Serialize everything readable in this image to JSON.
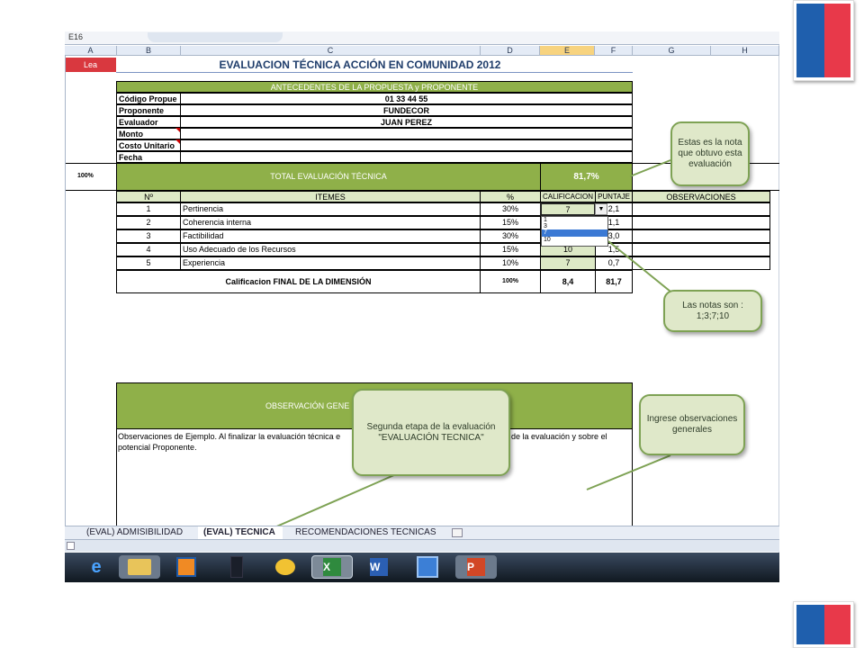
{
  "spreadsheet": {
    "cell_ref": "E16",
    "columns": [
      "A",
      "B",
      "C",
      "D",
      "E",
      "F",
      "G",
      "H"
    ],
    "lea_label": "Lea",
    "title": "EVALUACION TÉCNICA ACCIÓN EN COMUNIDAD 2012",
    "antecedentes_header": "ANTECEDENTES DE LA PROPUESTA y PROPONENTE",
    "info_rows": [
      {
        "label": "Código Propue",
        "value": "01 33 44 55"
      },
      {
        "label": "Proponente",
        "value": "FUNDECOR"
      },
      {
        "label": "Evaluador",
        "value": "JUAN PEREZ"
      },
      {
        "label": "Monto",
        "value": ""
      },
      {
        "label": "Costo Unitario",
        "value": ""
      },
      {
        "label": "Fecha",
        "value": ""
      }
    ],
    "total_pct_label": "100%",
    "total_label": "TOTAL EVALUACIÓN TÉCNICA",
    "total_value": "81,7%",
    "table_headers": {
      "n": "Nº",
      "items": "ITEMES",
      "pct": "%",
      "calif": "CALIFICACION",
      "puntaje": "PUNTAJE",
      "obs": "OBSERVACIONES"
    },
    "items": [
      {
        "n": "1",
        "name": "Pertinencia",
        "pct": "30%",
        "calif": "7",
        "puntaje": "2,1"
      },
      {
        "n": "2",
        "name": "Coherencia interna",
        "pct": "15%",
        "calif": "",
        "puntaje": "1,1"
      },
      {
        "n": "3",
        "name": "Factibilidad",
        "pct": "30%",
        "calif": "",
        "puntaje": "3,0"
      },
      {
        "n": "4",
        "name": "Uso Adecuado de los Recursos",
        "pct": "15%",
        "calif": "10",
        "puntaje": "1,5"
      },
      {
        "n": "5",
        "name": "Experiencia",
        "pct": "10%",
        "calif": "7",
        "puntaje": "0,7"
      }
    ],
    "dropdown_options": [
      "1",
      "3",
      "7",
      "10"
    ],
    "dropdown_selected": "7",
    "final_label": "Calificacion FINAL DE LA DIMENSIÓN",
    "final_pct": "100%",
    "final_calif": "8,4",
    "final_puntaje": "81,7",
    "obs_header": "OBSERVACIÓN GENE",
    "obs_text_1": "Observaciones de Ejemplo. Al finalizar la evaluación técnica e",
    "obs_text_1b": "de la evaluación y sobre el",
    "obs_text_2": "potencial Proponente."
  },
  "callouts": {
    "nota": "Estas es la nota que obtuvo esta evaluación",
    "notas": "Las notas son : 1;3;7;10",
    "ingrese": "Ingrese observaciones generales",
    "segunda": "Segunda etapa de la evaluación \"EVALUACIÓN TECNICA\""
  },
  "sheet_tabs": [
    "(EVAL) ADMISIBILIDAD",
    "(EVAL) TECNICA",
    "RECOMENDACIONES TECNICAS"
  ],
  "active_tab": "(EVAL) TECNICA",
  "taskbar": [
    "internet-explorer-icon",
    "folder-icon",
    "media-player-icon",
    "app-icon",
    "outlook-icon",
    "excel-icon",
    "word-icon",
    "reader-icon",
    "powerpoint-icon"
  ],
  "colors": {
    "green": "#8fb049",
    "light_green": "#dde9c6",
    "lea_red": "#d9383f",
    "flag_blue": "#1f5fad",
    "flag_red": "#e8394a"
  }
}
